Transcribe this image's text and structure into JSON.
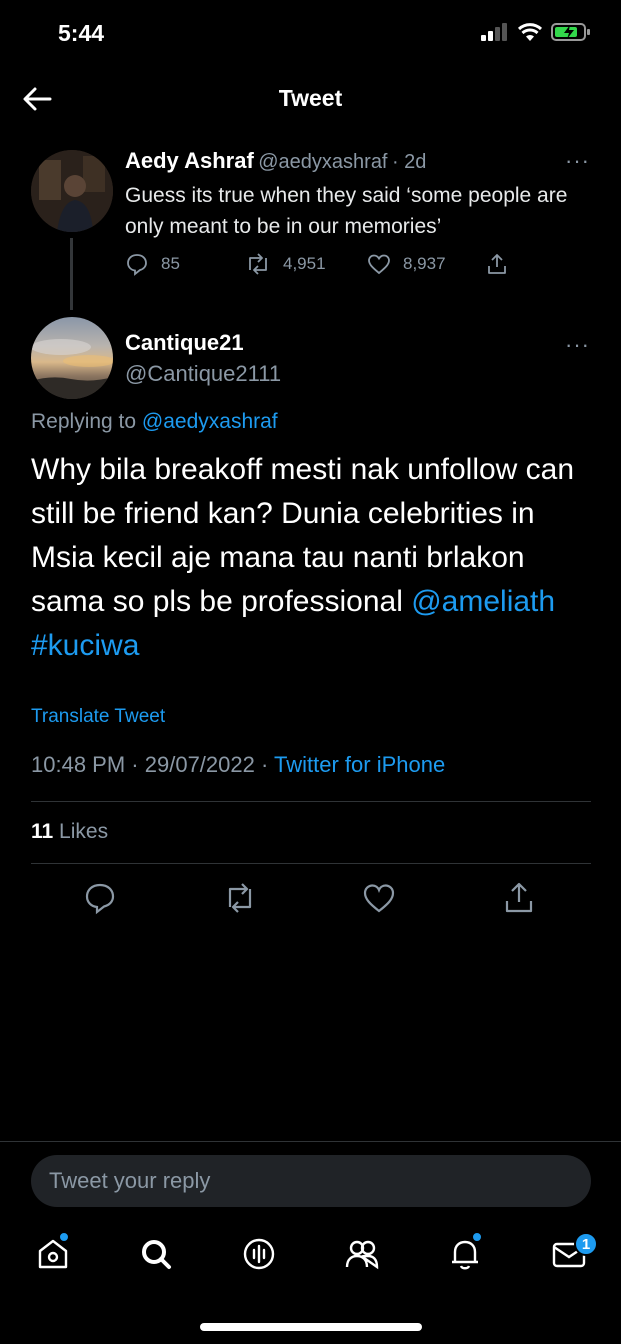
{
  "status_bar": {
    "time": "5:44"
  },
  "header": {
    "title": "Tweet"
  },
  "parent_tweet": {
    "author_name": "Aedy Ashraf",
    "handle": "@aedyxashraf",
    "age": "· 2d",
    "text": "Guess its true when they said ‘some people are only meant to be in our memories’",
    "replies": "85",
    "retweets": "4,951",
    "likes": "8,937",
    "more": "···"
  },
  "main_tweet": {
    "author_name": "Cantique21",
    "handle": "@Cantique2111",
    "more": "···",
    "replying_prefix": "Replying to",
    "replying_to": "@aedyxashraf",
    "text": "Why bila breakoff mesti nak unfollow can still be friend kan? Dunia celebrities in Msia kecil aje mana tau nanti brlakon sama so pls be professional",
    "mention": "@ameliath",
    "hashtag": "#kuciwa",
    "translate": "Translate Tweet",
    "time": "10:48 PM",
    "date": "29/07/2022",
    "source": "Twitter for iPhone",
    "likes_count": "11",
    "likes_label": "Likes"
  },
  "reply_box": {
    "placeholder": "Tweet your reply"
  },
  "tabbar": {
    "messages_badge": "1"
  },
  "colors": {
    "accent": "#1d9bf0",
    "background": "#000000",
    "muted": "#8b98a5"
  },
  "icons": [
    "back-arrow-icon",
    "reply-icon",
    "retweet-icon",
    "like-icon",
    "share-icon",
    "home-icon",
    "search-icon",
    "spaces-icon",
    "communities-icon",
    "notifications-icon",
    "messages-icon"
  ]
}
